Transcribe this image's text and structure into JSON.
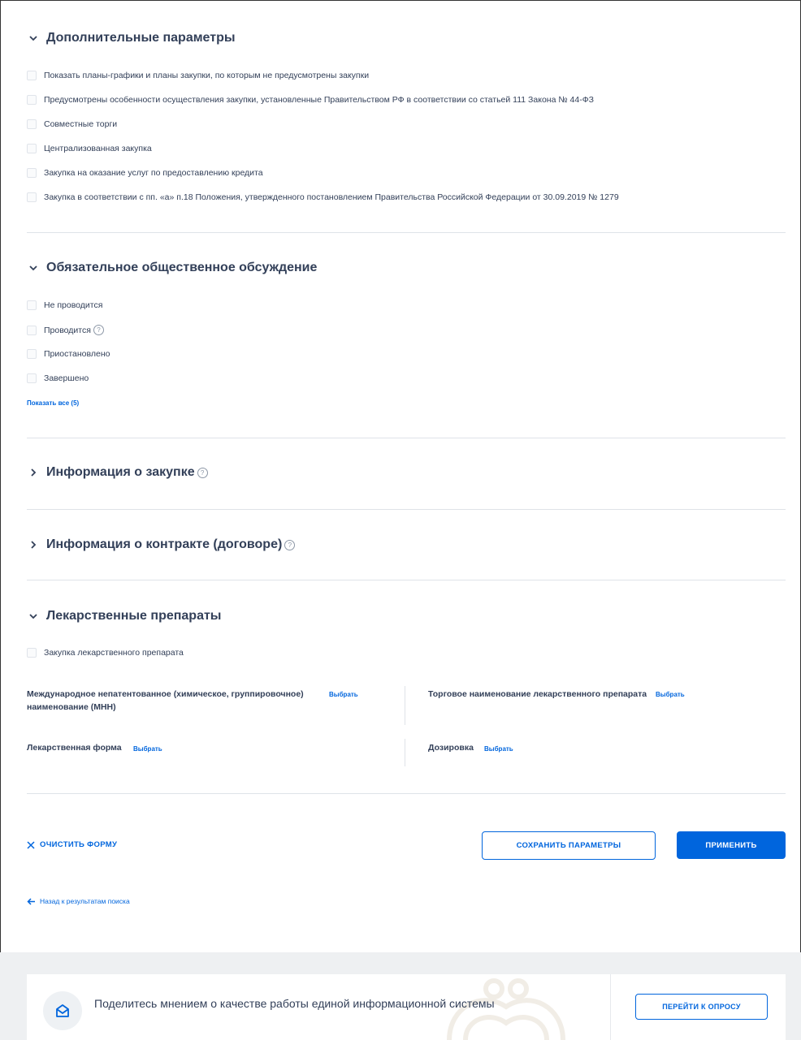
{
  "sections": {
    "additional": {
      "title": "Дополнительные параметры",
      "options": [
        "Показать планы-графики и планы закупки, по которым не предусмотрены закупки",
        "Предусмотрены особенности осуществления закупки, установленные Правительством РФ в соответствии со статьей 111 Закона № 44-ФЗ",
        "Совместные торги",
        "Централизованная закупка",
        "Закупка на оказание услуг по предоставлению кредита",
        "Закупка в соответствии с пп. «а» п.18 Положения, утвержденного постановлением Правительства Российской Федерации от 30.09.2019 № 1279"
      ]
    },
    "discussion": {
      "title": "Обязательное общественное обсуждение",
      "options": [
        "Не проводится",
        "Проводится",
        "Приостановлено",
        "Завершено"
      ],
      "show_all": "Показать все (5)"
    },
    "purchase_info": {
      "title": "Информация о закупке"
    },
    "contract_info": {
      "title": "Информация о контракте (договоре)"
    },
    "drugs": {
      "title": "Лекарственные препараты",
      "checkbox": "Закупка лекарственного препарата",
      "mnn_label": "Международное непатентованное (химическое, группировочное) наименование (МНН)",
      "trade_label": "Торговое наименование лекарственного препарата",
      "form_label": "Лекарственная форма",
      "dosage_label": "Дозировка",
      "select_label": "Выбрать"
    }
  },
  "actions": {
    "clear": "ОЧИСТИТЬ ФОРМУ",
    "save": "СОХРАНИТЬ ПАРАМЕТРЫ",
    "apply": "ПРИМЕНИТЬ",
    "back": "Назад к результатам поиска"
  },
  "survey": {
    "text": "Поделитесь мнением о качестве работы единой информационной системы",
    "button": "ПЕРЕЙТИ К ОПРОСУ"
  },
  "colors": {
    "accent": "#0065dd",
    "text": "#334059",
    "divider": "#dfe3e8"
  },
  "help_glyph": "?"
}
